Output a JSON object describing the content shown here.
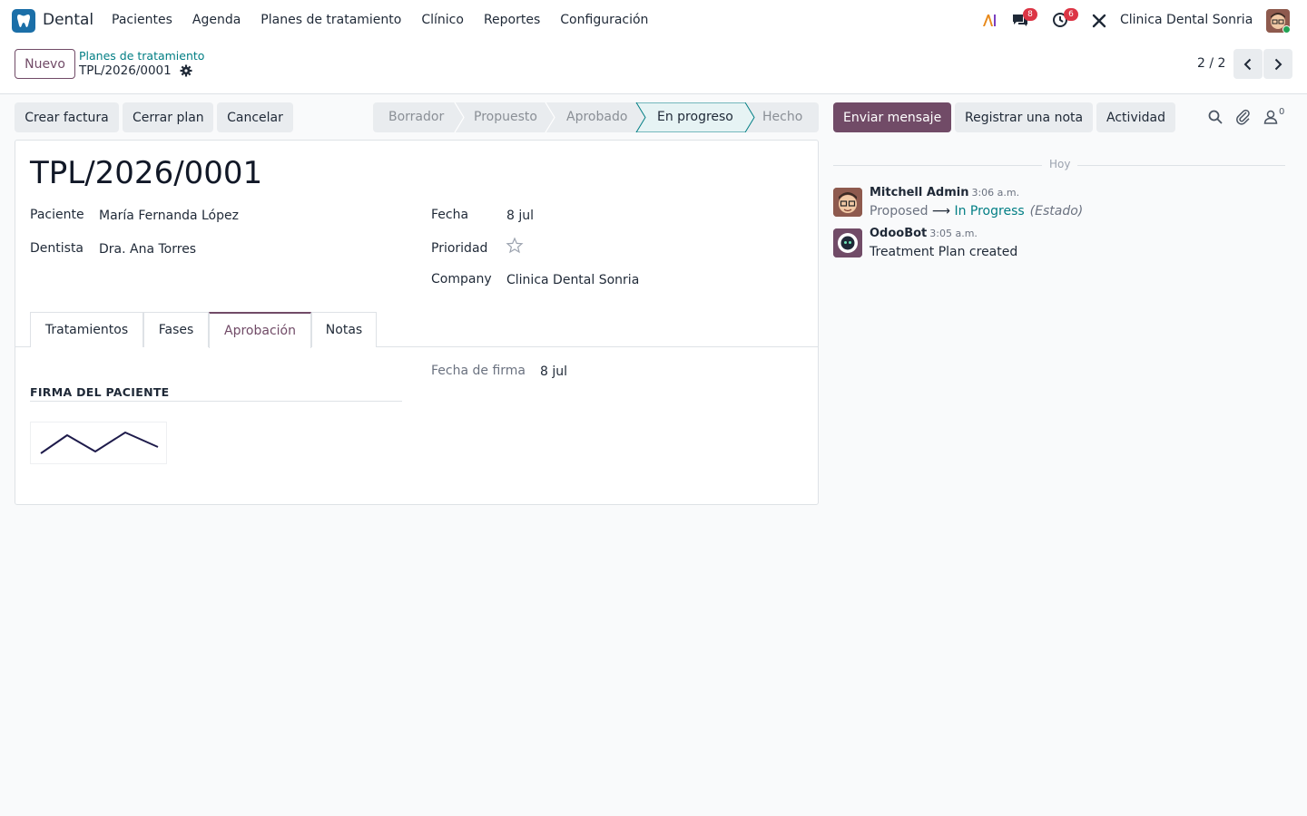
{
  "navbar": {
    "app_name": "Dental",
    "menu": [
      "Pacientes",
      "Agenda",
      "Planes de tratamiento",
      "Clínico",
      "Reportes",
      "Configuración"
    ],
    "messages_badge": "8",
    "activities_badge": "6",
    "company": "Clinica Dental Sonria"
  },
  "control": {
    "new_label": "Nuevo",
    "breadcrumb_parent": "Planes de tratamiento",
    "breadcrumb_current": "TPL/2026/0001",
    "pager": "2 / 2"
  },
  "actions": {
    "create_invoice": "Crear factura",
    "close_plan": "Cerrar plan",
    "cancel": "Cancelar"
  },
  "statusbar": {
    "stages": [
      "Borrador",
      "Propuesto",
      "Aprobado",
      "En progreso",
      "Hecho"
    ],
    "active": "En progreso"
  },
  "form": {
    "title": "TPL/2026/0001",
    "patient_label": "Paciente",
    "patient_value": "María Fernanda López",
    "dentist_label": "Dentista",
    "dentist_value": "Dra. Ana Torres",
    "date_label": "Fecha",
    "date_value": "8 jul",
    "priority_label": "Prioridad",
    "priority_stars": 0,
    "company_label": "Company",
    "company_value": "Clinica Dental Sonria",
    "tabs": [
      "Tratamientos",
      "Fases",
      "Aprobación",
      "Notas"
    ],
    "active_tab": "Aprobación",
    "signature_date_label": "Fecha de firma",
    "signature_date_value": "8 jul",
    "signature_section": "FIRMA DEL PACIENTE"
  },
  "chatter": {
    "send_message": "Enviar mensaje",
    "log_note": "Registrar una nota",
    "activity": "Actividad",
    "followers_count": "0",
    "today_label": "Hoy",
    "messages": [
      {
        "author": "Mitchell Admin",
        "time": "3:06 a.m.",
        "old_value": "Proposed",
        "arrow": "⟶",
        "new_value": "In Progress",
        "field": "(Estado)"
      },
      {
        "author": "OdooBot",
        "time": "3:05 a.m.",
        "body": "Treatment Plan created"
      }
    ]
  },
  "colors": {
    "brand": "#714b67",
    "teal": "#017e84",
    "badge": "#dc3545",
    "app_icon": "#1b6fa8"
  }
}
